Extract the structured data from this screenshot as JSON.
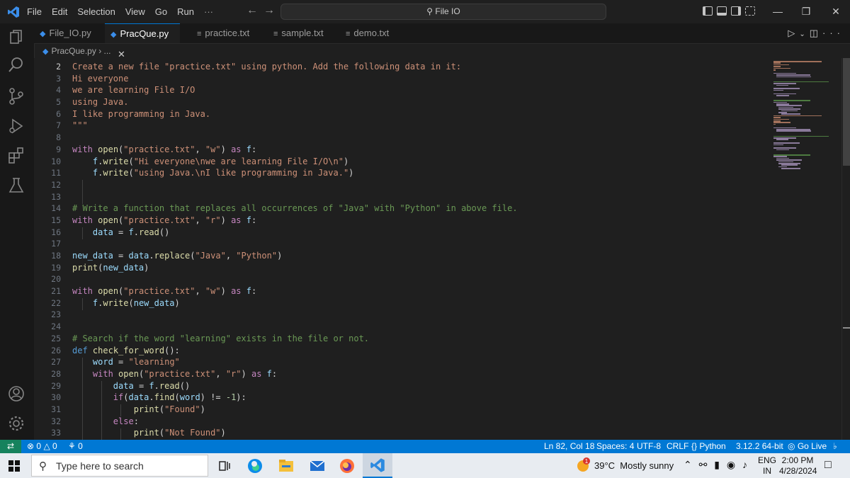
{
  "titlebar": {
    "menu": [
      "File",
      "Edit",
      "Selection",
      "View",
      "Go",
      "Run",
      "···"
    ],
    "command_center": "File IO"
  },
  "tabs": [
    {
      "label": "File_IO.py",
      "kind": "py",
      "active": false
    },
    {
      "label": "PracQue.py",
      "kind": "py",
      "active": true
    },
    {
      "label": "practice.txt",
      "kind": "txt",
      "active": false
    },
    {
      "label": "sample.txt",
      "kind": "txt",
      "active": false
    },
    {
      "label": "demo.txt",
      "kind": "txt",
      "active": false
    }
  ],
  "breadcrumb": {
    "file": "PracQue.py",
    "more": "› ..."
  },
  "editor": {
    "line_numbers": [
      "2",
      "3",
      "4",
      "5",
      "6",
      "7",
      "8",
      "9",
      "10",
      "11",
      "12",
      "13",
      "14",
      "15",
      "16",
      "17",
      "18",
      "19",
      "20",
      "21",
      "22",
      "23",
      "24",
      "25",
      "26",
      "27",
      "28",
      "29",
      "30",
      "31",
      "32",
      "33"
    ],
    "code_lines": [
      "Create a new file \"practice.txt\" using python. Add the following data in it:",
      "Hi everyone",
      "we are learning File I/O",
      "using Java.",
      "I like programming in Java.",
      "\"\"\"",
      "",
      "with open(\"practice.txt\", \"w\") as f:",
      "    f.write(\"Hi everyone\\nwe are learning File I/O\\n\")",
      "    f.write(\"using Java.\\nI like programming in Java.\")",
      "",
      "",
      "# Write a function that replaces all occurrences of \"Java\" with \"Python\" in above file.",
      "with open(\"practice.txt\", \"r\") as f:",
      "    data = f.read()",
      "",
      "new_data = data.replace(\"Java\", \"Python\")",
      "print(new_data)",
      "",
      "with open(\"practice.txt\", \"w\") as f:",
      "    f.write(new_data)",
      "",
      "",
      "# Search if the word \"learning\" exists in the file or not.",
      "def check_for_word():",
      "    word = \"learning\"",
      "    with open(\"practice.txt\", \"r\") as f:",
      "        data = f.read()",
      "        if(data.find(word) != -1):",
      "            print(\"Found\")",
      "        else:",
      "            print(\"Not Found\")"
    ]
  },
  "statusbar": {
    "errors": "0",
    "warnings": "0",
    "ports": "0",
    "position": "Ln 82, Col 18",
    "spaces": "Spaces: 4",
    "encoding": "UTF-8",
    "eol": "CRLF",
    "language": "Python",
    "interpreter": "3.12.2 64-bit",
    "golive": "Go Live"
  },
  "taskbar": {
    "search_placeholder": "Type here to search",
    "weather": "39°C  Mostly sunny",
    "weather_badge": "1",
    "lang": "ENG",
    "region": "IN",
    "time": "2:00 PM",
    "date": "4/28/2024"
  },
  "colors": {
    "accent": "#0078d4",
    "string": "#ce9178",
    "keyword": "#c586c0",
    "comment": "#6a9955",
    "function": "#dcdcaa",
    "variable": "#9cdcfe"
  }
}
